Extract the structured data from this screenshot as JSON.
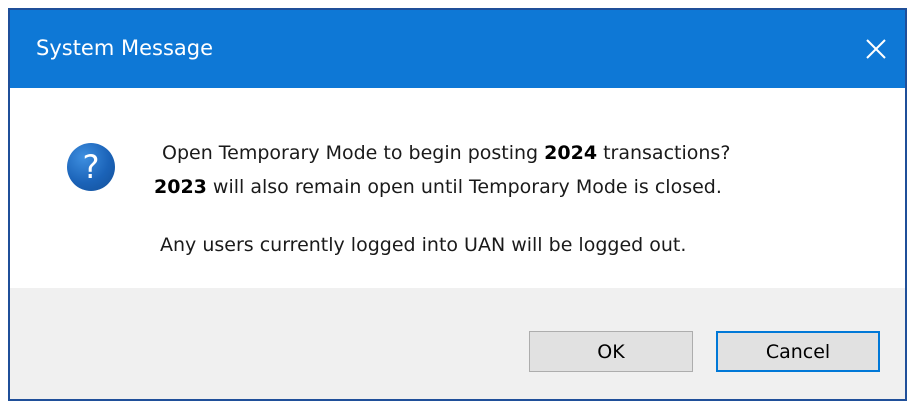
{
  "window": {
    "title": "System Message",
    "close_glyph": "✕",
    "title_bar_color": "#0e78d6"
  },
  "icon": {
    "name": "question-icon",
    "glyph": "?"
  },
  "message": {
    "line1_prefix": "Open Temporary Mode to begin posting ",
    "line1_year": "2024",
    "line1_suffix": " transactions?",
    "line2_year": "2023",
    "line2_suffix": " will also remain open until Temporary Mode is closed.",
    "line3": "Any users currently logged into UAN will be logged out."
  },
  "buttons": {
    "ok_label": "OK",
    "cancel_label": "Cancel"
  }
}
